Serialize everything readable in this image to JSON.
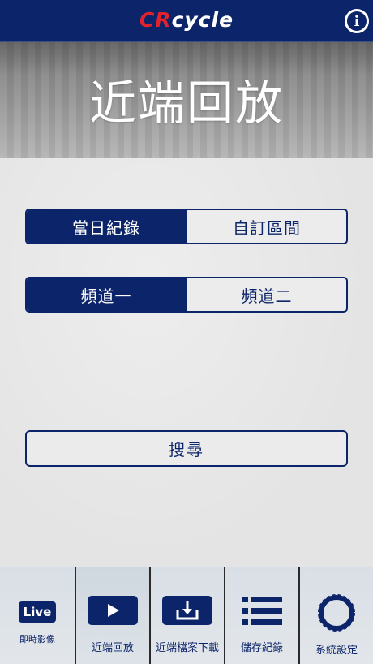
{
  "header": {
    "logo_cr": "CR",
    "logo_cycle": "cycle",
    "info_label": "i"
  },
  "banner": {
    "title": "近端回放"
  },
  "range_toggle": {
    "options": [
      "當日紀錄",
      "自訂區間"
    ],
    "selected": "當日紀錄"
  },
  "channel_toggle": {
    "options": [
      "頻道一",
      "頻道二"
    ],
    "selected": "頻道一"
  },
  "search": {
    "label": "搜尋"
  },
  "tabbar": {
    "tabs": [
      {
        "icon": "live-icon",
        "icon_text": "Live",
        "label": "即時影像"
      },
      {
        "icon": "play-icon",
        "label": "近端回放"
      },
      {
        "icon": "download-icon",
        "label": "近端檔案下載"
      },
      {
        "icon": "list-icon",
        "label": "儲存紀錄"
      },
      {
        "icon": "tire-icon",
        "label": "系統設定"
      }
    ],
    "active": "近端回放"
  },
  "colors": {
    "brand_navy": "#0c2469",
    "logo_red": "#e3232c",
    "background": "#e6e6e6"
  }
}
